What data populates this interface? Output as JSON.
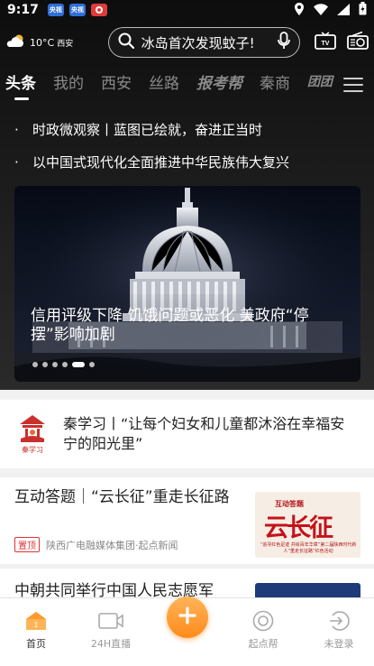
{
  "status_bar": {
    "time": "9:17",
    "apps": [
      {
        "name": "app-badge-1",
        "label": "央视",
        "color": "#2f6fd6"
      },
      {
        "name": "app-badge-2",
        "label": "央视",
        "color": "#2f6fd6"
      },
      {
        "name": "app-badge-3",
        "label": "",
        "color": "#e03b3b"
      }
    ]
  },
  "header": {
    "weather": {
      "temp": "10°C",
      "city": "西安"
    },
    "search": {
      "text": "冰岛首次发现蚊子!"
    }
  },
  "tabs": [
    {
      "label": "头条",
      "active": true
    },
    {
      "label": "我的"
    },
    {
      "label": "西安"
    },
    {
      "label": "丝路"
    },
    {
      "label": "报考帮"
    },
    {
      "label": "秦商"
    },
    {
      "label": "团团"
    }
  ],
  "headlines": [
    "时政微观察丨蓝图已绘就，奋进正当时",
    "以中国式现代化全面推进中华民族伟大复兴"
  ],
  "banner": {
    "caption": "信用评级下降 饥饿问题或恶化 美政府“停摆”影响加剧",
    "dot_count": 6,
    "active_dot": 4
  },
  "study": {
    "logo_label": "秦学习",
    "text": "秦学习丨“让每个妇女和儿童都沐浴在幸福安宁的阳光里”"
  },
  "news": [
    {
      "title": "互动答题｜“云长征”重走长征路",
      "tag": "置顶",
      "source": "陕西广电融媒体集团·起点新闻",
      "thumb": {
        "kicker": "互动答题",
        "main": "云长征",
        "sub": "“追寻红色足迹 共绘百年华章”第二届陕西时代新人“重走长征路”红色活动"
      }
    },
    {
      "title": "中朝共同举行中国人民志愿军"
    }
  ],
  "bottom_nav": [
    {
      "label": "首页",
      "icon": "home-icon",
      "active": true
    },
    {
      "label": "24H直播",
      "icon": "live-tv-icon"
    },
    {
      "label": "起点帮",
      "icon": "qidian-help-icon"
    },
    {
      "label": "未登录",
      "icon": "login-icon"
    }
  ],
  "colors": {
    "accent": "#ff8b1a",
    "tag_red": "#dd3333",
    "dark_bg": "#1a1a1a"
  }
}
